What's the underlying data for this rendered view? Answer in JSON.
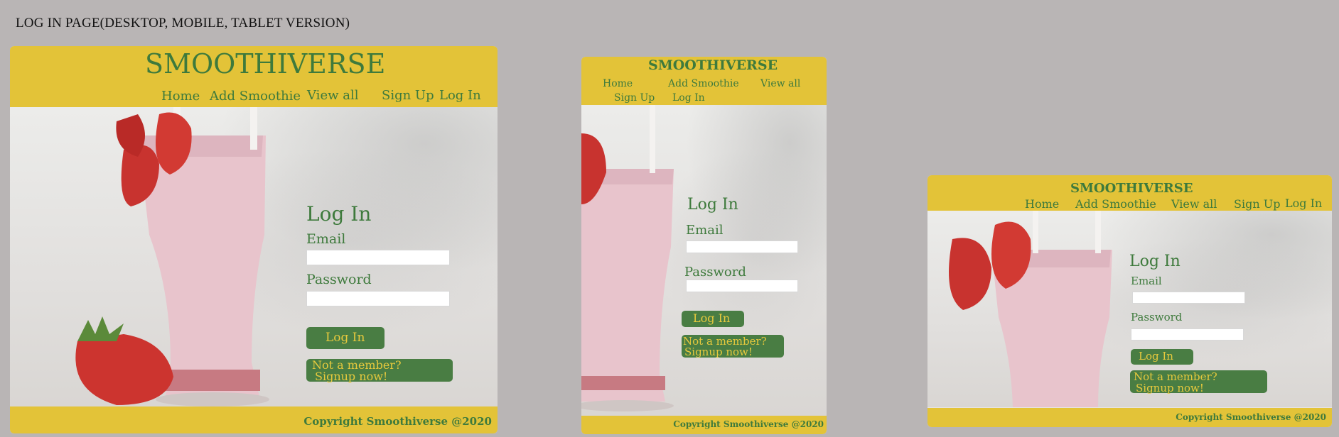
{
  "caption": "LOG IN PAGE(DESKTOP, MOBILE, TABLET VERSION)",
  "desktop": {
    "brand": "SMOOTHIVERSE",
    "nav": [
      "Home",
      "Add Smoothie",
      "View all",
      "Sign Up",
      "Log In"
    ],
    "heading": "Log In",
    "email_label": "Email",
    "password_label": "Password",
    "email_value": "",
    "password_value": "",
    "login_button": "Log In",
    "signup_line1": "Not a member?",
    "signup_line2": "Signup now!",
    "copyright": "Copyright Smoothiverse @2020"
  },
  "mobile": {
    "brand": "SMOOTHIVERSE",
    "nav": [
      "Home",
      "Add Smoothie",
      "View all",
      "Sign Up",
      "Log In"
    ],
    "heading": "Log In",
    "email_label": "Email",
    "password_label": "Password",
    "login_button": "Log In",
    "signup_line1": "Not a member?",
    "signup_line2": "Signup now!",
    "copyright": "Copyright Smoothiverse @2020"
  },
  "tablet": {
    "brand": "SMOOTHIVERSE",
    "nav": [
      "Home",
      "Add Smoothie",
      "View all",
      "Sign Up",
      "Log In"
    ],
    "heading": "Log In",
    "email_label": "Email",
    "password_label": "Password",
    "login_button": "Log In",
    "signup_line1": "Not a member?",
    "signup_line2": "Signup now!",
    "copyright": "Copyright Smoothiverse @2020"
  },
  "colors": {
    "background": "#b9b5b5",
    "header_yellow": "#e3c338",
    "brand_green": "#3e7a3c",
    "button_green": "#497d43",
    "button_text": "#e7c93d"
  }
}
